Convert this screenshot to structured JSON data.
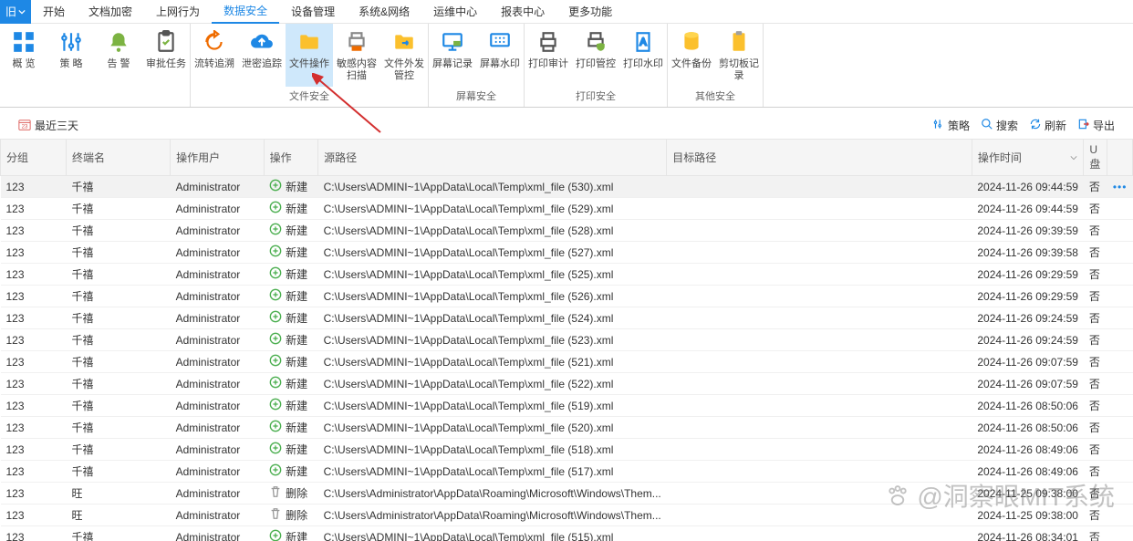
{
  "menu": {
    "old_label": "旧",
    "tabs": [
      "开始",
      "文档加密",
      "上网行为",
      "数据安全",
      "设备管理",
      "系统&网络",
      "运维中心",
      "报表中心",
      "更多功能"
    ],
    "active_index": 3
  },
  "ribbon": {
    "groups": [
      {
        "title": "",
        "items": [
          {
            "name": "overview",
            "label": "概 览",
            "icon": "grid"
          },
          {
            "name": "policy",
            "label": "策 略",
            "icon": "sliders"
          },
          {
            "name": "alarm",
            "label": "告 警",
            "icon": "bell"
          },
          {
            "name": "approval",
            "label": "审批任务",
            "icon": "clipboard"
          }
        ]
      },
      {
        "title": "文件安全",
        "items": [
          {
            "name": "flow-trace",
            "label": "流转追溯",
            "icon": "rotate"
          },
          {
            "name": "leak-trace",
            "label": "泄密追踪",
            "icon": "cloud-up"
          },
          {
            "name": "file-ops",
            "label": "文件操作",
            "icon": "folder",
            "active": true
          },
          {
            "name": "sens-scan",
            "label": "敏感内容扫描",
            "icon": "printer-scan"
          },
          {
            "name": "file-out",
            "label": "文件外发管控",
            "icon": "folder-arrow"
          }
        ]
      },
      {
        "title": "屏幕安全",
        "items": [
          {
            "name": "screen-record",
            "label": "屏幕记录",
            "icon": "monitor"
          },
          {
            "name": "screen-wm",
            "label": "屏幕水印",
            "icon": "monitor-grid"
          }
        ]
      },
      {
        "title": "打印安全",
        "items": [
          {
            "name": "print-audit",
            "label": "打印审计",
            "icon": "printer"
          },
          {
            "name": "print-ctrl",
            "label": "打印管控",
            "icon": "printer-shield"
          },
          {
            "name": "print-wm",
            "label": "打印水印",
            "icon": "page"
          }
        ]
      },
      {
        "title": "其他安全",
        "items": [
          {
            "name": "file-backup",
            "label": "文件备份",
            "icon": "db"
          },
          {
            "name": "clipboard-rec",
            "label": "剪切板记录",
            "icon": "clipboard2"
          }
        ]
      }
    ]
  },
  "filter": {
    "recent_label": "最近三天",
    "buttons": [
      {
        "name": "policy",
        "label": "策略",
        "icon": "sliders"
      },
      {
        "name": "search",
        "label": "搜索",
        "icon": "search"
      },
      {
        "name": "refresh",
        "label": "刷新",
        "icon": "refresh"
      },
      {
        "name": "export",
        "label": "导出",
        "icon": "export"
      }
    ]
  },
  "columns": [
    "分组",
    "终端名",
    "操作用户",
    "操作",
    "源路径",
    "目标路径",
    "操作时间",
    "U盘"
  ],
  "op_new_label": "新建",
  "op_del_label": "删除",
  "rows": [
    {
      "g": "123",
      "t": "千禧",
      "u": "Administrator",
      "op": "new",
      "src": "C:\\Users\\ADMINI~1\\AppData\\Local\\Temp\\xml_file (530).xml",
      "dst": "",
      "time": "2024-11-26 09:44:59",
      "usb": "否",
      "sel": true,
      "more": true
    },
    {
      "g": "123",
      "t": "千禧",
      "u": "Administrator",
      "op": "new",
      "src": "C:\\Users\\ADMINI~1\\AppData\\Local\\Temp\\xml_file (529).xml",
      "dst": "",
      "time": "2024-11-26 09:44:59",
      "usb": "否"
    },
    {
      "g": "123",
      "t": "千禧",
      "u": "Administrator",
      "op": "new",
      "src": "C:\\Users\\ADMINI~1\\AppData\\Local\\Temp\\xml_file (528).xml",
      "dst": "",
      "time": "2024-11-26 09:39:59",
      "usb": "否"
    },
    {
      "g": "123",
      "t": "千禧",
      "u": "Administrator",
      "op": "new",
      "src": "C:\\Users\\ADMINI~1\\AppData\\Local\\Temp\\xml_file (527).xml",
      "dst": "",
      "time": "2024-11-26 09:39:58",
      "usb": "否"
    },
    {
      "g": "123",
      "t": "千禧",
      "u": "Administrator",
      "op": "new",
      "src": "C:\\Users\\ADMINI~1\\AppData\\Local\\Temp\\xml_file (525).xml",
      "dst": "",
      "time": "2024-11-26 09:29:59",
      "usb": "否"
    },
    {
      "g": "123",
      "t": "千禧",
      "u": "Administrator",
      "op": "new",
      "src": "C:\\Users\\ADMINI~1\\AppData\\Local\\Temp\\xml_file (526).xml",
      "dst": "",
      "time": "2024-11-26 09:29:59",
      "usb": "否"
    },
    {
      "g": "123",
      "t": "千禧",
      "u": "Administrator",
      "op": "new",
      "src": "C:\\Users\\ADMINI~1\\AppData\\Local\\Temp\\xml_file (524).xml",
      "dst": "",
      "time": "2024-11-26 09:24:59",
      "usb": "否"
    },
    {
      "g": "123",
      "t": "千禧",
      "u": "Administrator",
      "op": "new",
      "src": "C:\\Users\\ADMINI~1\\AppData\\Local\\Temp\\xml_file (523).xml",
      "dst": "",
      "time": "2024-11-26 09:24:59",
      "usb": "否"
    },
    {
      "g": "123",
      "t": "千禧",
      "u": "Administrator",
      "op": "new",
      "src": "C:\\Users\\ADMINI~1\\AppData\\Local\\Temp\\xml_file (521).xml",
      "dst": "",
      "time": "2024-11-26 09:07:59",
      "usb": "否"
    },
    {
      "g": "123",
      "t": "千禧",
      "u": "Administrator",
      "op": "new",
      "src": "C:\\Users\\ADMINI~1\\AppData\\Local\\Temp\\xml_file (522).xml",
      "dst": "",
      "time": "2024-11-26 09:07:59",
      "usb": "否"
    },
    {
      "g": "123",
      "t": "千禧",
      "u": "Administrator",
      "op": "new",
      "src": "C:\\Users\\ADMINI~1\\AppData\\Local\\Temp\\xml_file (519).xml",
      "dst": "",
      "time": "2024-11-26 08:50:06",
      "usb": "否"
    },
    {
      "g": "123",
      "t": "千禧",
      "u": "Administrator",
      "op": "new",
      "src": "C:\\Users\\ADMINI~1\\AppData\\Local\\Temp\\xml_file (520).xml",
      "dst": "",
      "time": "2024-11-26 08:50:06",
      "usb": "否"
    },
    {
      "g": "123",
      "t": "千禧",
      "u": "Administrator",
      "op": "new",
      "src": "C:\\Users\\ADMINI~1\\AppData\\Local\\Temp\\xml_file (518).xml",
      "dst": "",
      "time": "2024-11-26 08:49:06",
      "usb": "否"
    },
    {
      "g": "123",
      "t": "千禧",
      "u": "Administrator",
      "op": "new",
      "src": "C:\\Users\\ADMINI~1\\AppData\\Local\\Temp\\xml_file (517).xml",
      "dst": "",
      "time": "2024-11-26 08:49:06",
      "usb": "否"
    },
    {
      "g": "123",
      "t": "旺",
      "u": "Administrator",
      "op": "del",
      "src": "C:\\Users\\Administrator\\AppData\\Roaming\\Microsoft\\Windows\\Them...",
      "dst": "",
      "time": "2024-11-25 09:38:00",
      "usb": "否"
    },
    {
      "g": "123",
      "t": "旺",
      "u": "Administrator",
      "op": "del",
      "src": "C:\\Users\\Administrator\\AppData\\Roaming\\Microsoft\\Windows\\Them...",
      "dst": "",
      "time": "2024-11-25 09:38:00",
      "usb": "否"
    },
    {
      "g": "123",
      "t": "千禧",
      "u": "Administrator",
      "op": "new",
      "src": "C:\\Users\\ADMINI~1\\AppData\\Local\\Temp\\xml_file (515).xml",
      "dst": "",
      "time": "2024-11-26 08:34:01",
      "usb": "否"
    }
  ],
  "watermark": "@洞察眼MIT系统"
}
